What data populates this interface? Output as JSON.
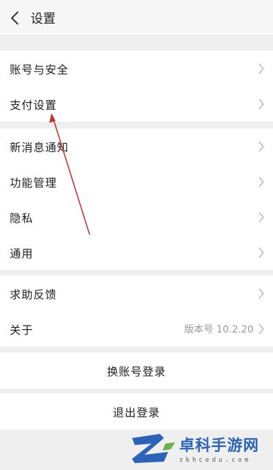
{
  "header": {
    "title": "设置",
    "back_icon": "chevron-left-icon"
  },
  "groups": [
    {
      "items": [
        {
          "label": "账号与安全",
          "icon": "chevron-right-icon"
        },
        {
          "label": "支付设置",
          "icon": "chevron-right-icon"
        }
      ]
    },
    {
      "items": [
        {
          "label": "新消息通知",
          "icon": "chevron-right-icon"
        },
        {
          "label": "功能管理",
          "icon": "chevron-right-icon"
        },
        {
          "label": "隐私",
          "icon": "chevron-right-icon"
        },
        {
          "label": "通用",
          "icon": "chevron-right-icon"
        }
      ]
    },
    {
      "items": [
        {
          "label": "求助反馈",
          "icon": "chevron-right-icon"
        },
        {
          "label": "关于",
          "value": "版本号 10.2.20",
          "icon": "chevron-right-icon"
        }
      ]
    }
  ],
  "actions": {
    "switch_account": "换账号登录",
    "logout": "退出登录"
  },
  "annotation": {
    "arrow_color": "#c0342a"
  },
  "watermark": {
    "name": "卓科手游网",
    "domain": "zkhcedu.com",
    "color": "#2a63b8"
  }
}
